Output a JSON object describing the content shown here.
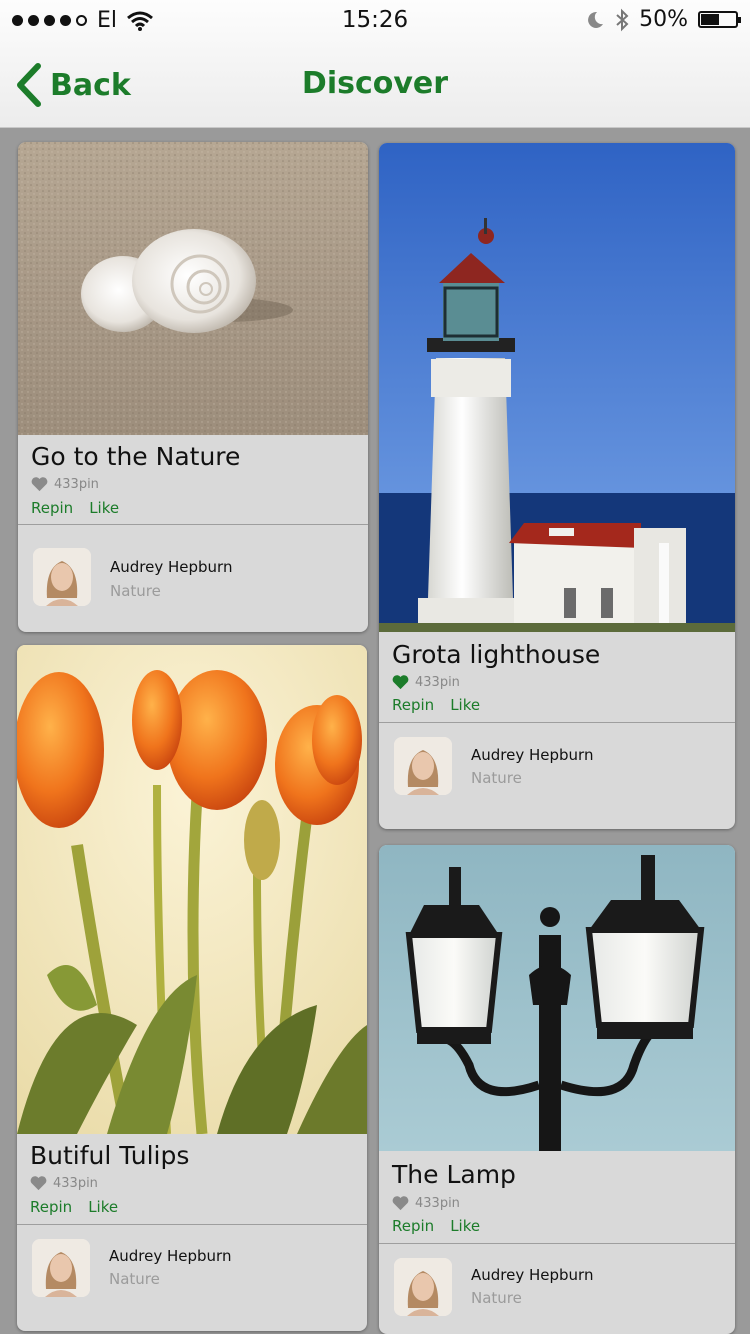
{
  "status_bar": {
    "carrier": "El",
    "time": "15:26",
    "battery": "50%"
  },
  "nav": {
    "back_label": "Back",
    "title": "Discover"
  },
  "cards": [
    {
      "title": "Go to the Nature",
      "pins": "433pin",
      "repin": "Repin",
      "like": "Like",
      "user": "Audrey Hepburn",
      "category": "Nature",
      "liked": false
    },
    {
      "title": "Grota lighthouse",
      "pins": "433pin",
      "repin": "Repin",
      "like": "Like",
      "user": "Audrey Hepburn",
      "category": "Nature",
      "liked": true
    },
    {
      "title": "Butiful Tulips",
      "pins": "433pin",
      "repin": "Repin",
      "like": "Like",
      "user": "Audrey Hepburn",
      "category": "Nature",
      "liked": false
    },
    {
      "title": "The Lamp",
      "pins": "433pin",
      "repin": "Repin",
      "like": "Like",
      "user": "Audrey Hepburn",
      "category": "Nature",
      "liked": false
    }
  ],
  "colors": {
    "accent": "#1c7c2a",
    "heart_inactive": "#8a8a8a",
    "heart_active": "#1c7c2a"
  }
}
